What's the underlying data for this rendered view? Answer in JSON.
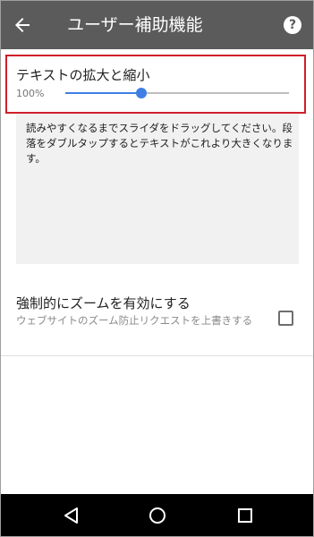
{
  "appbar": {
    "title": "ユーザー補助機能",
    "back_icon": "arrow-back-icon",
    "help_icon": "help-icon",
    "help_glyph": "?"
  },
  "text_scaling": {
    "title": "テキストの拡大と縮小",
    "percent_label": "100%",
    "slider_level": 0.34,
    "accent_color": "#3f7fe4",
    "highlight_color": "#cf1f2b"
  },
  "preview": {
    "text": "読みやすくなるまでスライダをドラッグしてください。段落をダブルタップするとテキストがこれより大きくなります。"
  },
  "force_zoom": {
    "title": "強制的にズームを有効にする",
    "description": "ウェブサイトのズーム防止リクエストを上書きする",
    "checked": false
  },
  "navbar": {
    "icons": [
      "nav-back-icon",
      "nav-home-icon",
      "nav-recents-icon"
    ]
  }
}
